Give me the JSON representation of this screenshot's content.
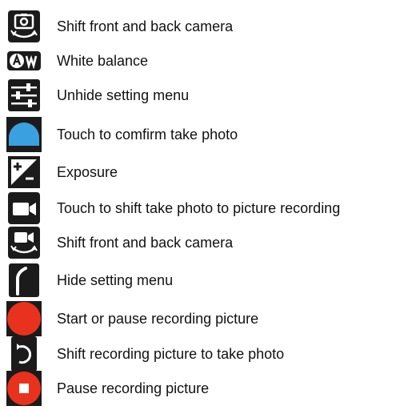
{
  "colors": {
    "tile": "#1b1b1b",
    "accent_blue": "#3aa0e0",
    "record_red": "#e8321d",
    "text": "#111111"
  },
  "items": [
    {
      "icon": "switch-camera-icon",
      "label": "Shift front and back camera"
    },
    {
      "icon": "white-balance-icon",
      "label": "White balance"
    },
    {
      "icon": "settings-sliders-icon",
      "label": "Unhide setting menu"
    },
    {
      "icon": "shutter-button-icon",
      "label": "Touch to comfirm take photo"
    },
    {
      "icon": "exposure-icon",
      "label": "Exposure"
    },
    {
      "icon": "video-camera-icon",
      "label": "Touch to shift take photo to picture recording"
    },
    {
      "icon": "switch-camera-video-icon",
      "label": "Shift front and back camera"
    },
    {
      "icon": "collapse-menu-icon",
      "label": "Hide setting menu"
    },
    {
      "icon": "record-button-icon",
      "label": "Start or pause recording picture"
    },
    {
      "icon": "switch-to-photo-icon",
      "label": "Shift recording picture to take photo"
    },
    {
      "icon": "stop-recording-icon",
      "label": "Pause recording picture"
    }
  ]
}
